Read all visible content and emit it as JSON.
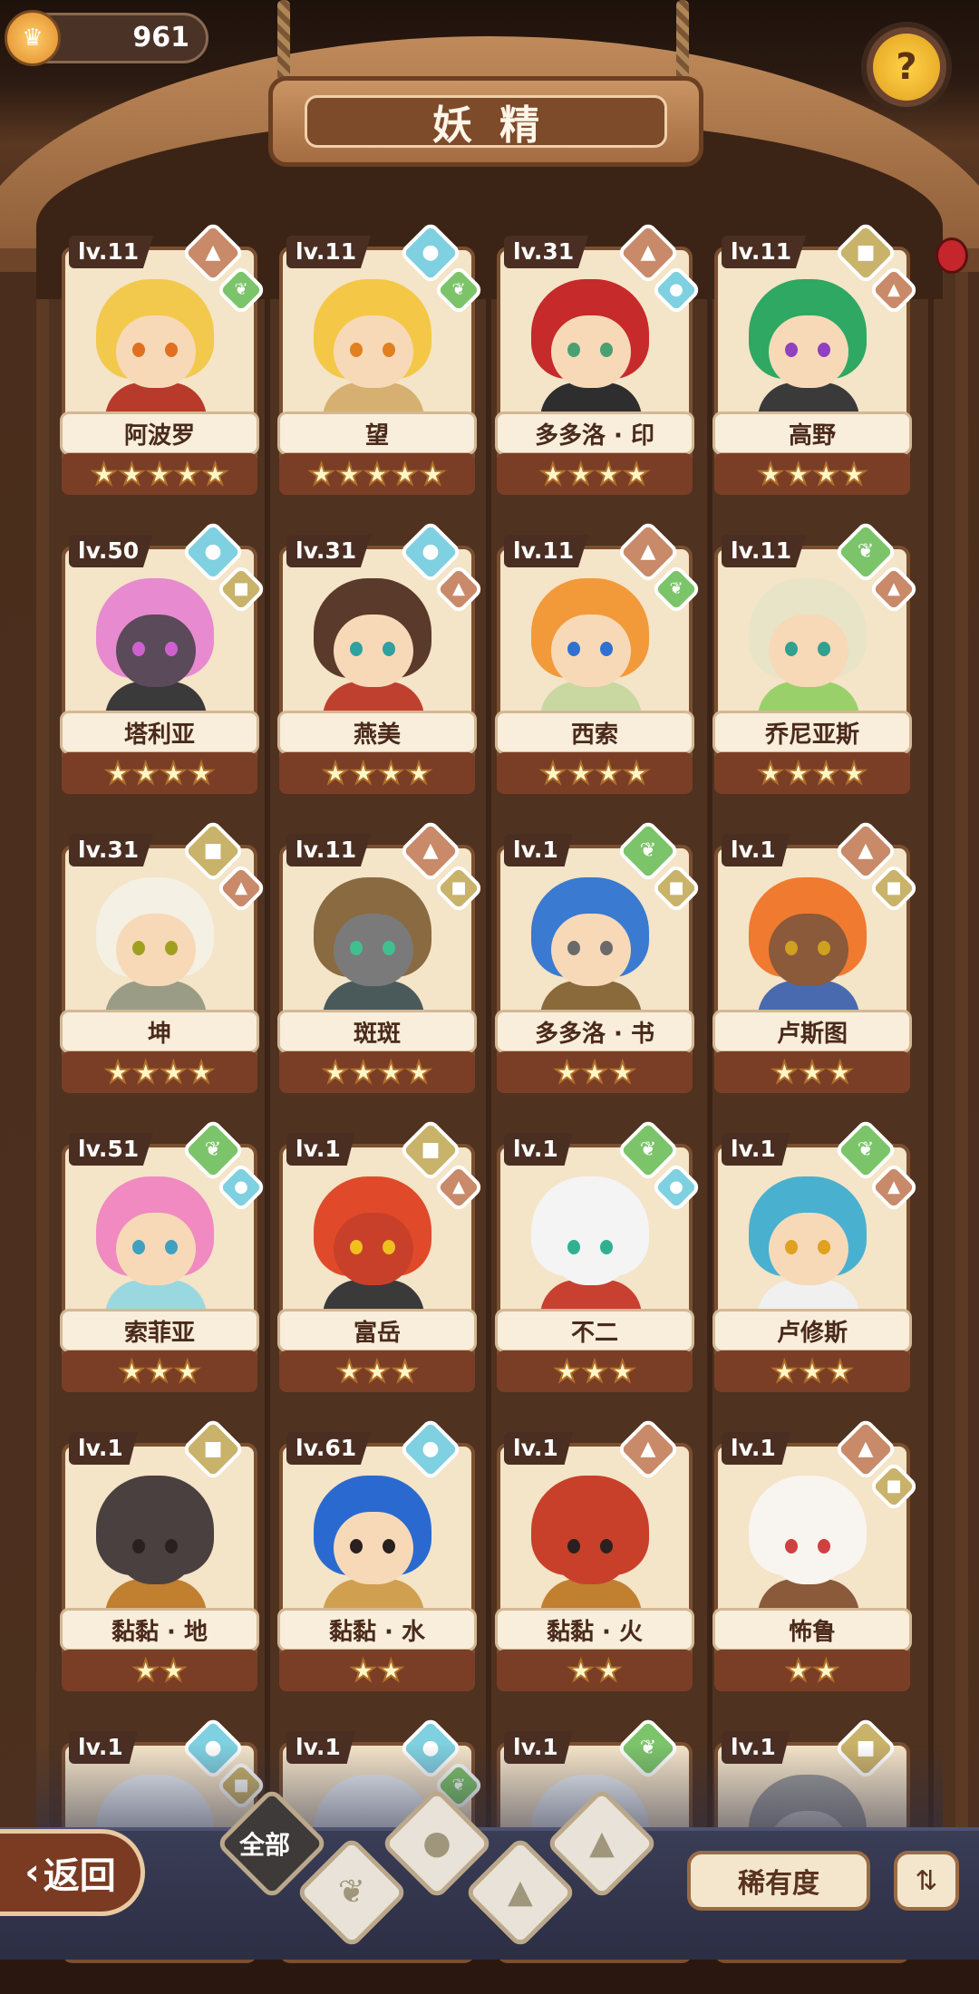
{
  "currency": {
    "value": "961"
  },
  "header": {
    "title": "妖精"
  },
  "bottom_bar": {
    "back_label": "返回",
    "filter_all_label": "全部",
    "sort_label": "稀有度",
    "sort_order_glyph": "⇅"
  },
  "colors": {
    "fire": "#c98a6a",
    "water": "#7fd0e0",
    "plant": "#7cc46a",
    "earth": "#c9b26a"
  },
  "fairies": [
    {
      "level": "lv.11",
      "name": "阿波罗",
      "stars": 5,
      "element": "fire",
      "secondary": "plant",
      "hair": "#f2c94c",
      "skin": "#f7d9b8",
      "outfit": "#b83a2a",
      "eye": "#e07020"
    },
    {
      "level": "lv.11",
      "name": "望",
      "stars": 5,
      "element": "water",
      "secondary": "plant",
      "hair": "#f4c846",
      "skin": "#f7d9b8",
      "outfit": "#d6b070",
      "eye": "#e08020"
    },
    {
      "level": "lv.31",
      "name": "多多洛 · 印",
      "stars": 4,
      "element": "fire",
      "secondary": "water",
      "hair": "#c62a2a",
      "skin": "#f7d9b8",
      "outfit": "#2e2e2e",
      "eye": "#4aa070"
    },
    {
      "level": "lv.11",
      "name": "高野",
      "stars": 4,
      "element": "earth",
      "secondary": "fire",
      "hair": "#2ea862",
      "skin": "#f7d9b8",
      "outfit": "#3a3a3a",
      "eye": "#9040c0"
    },
    {
      "level": "lv.50",
      "name": "塔利亚",
      "stars": 4,
      "element": "water",
      "secondary": "earth",
      "hair": "#e88ad0",
      "skin": "#5a4a5a",
      "outfit": "#3a3a3a",
      "eye": "#d060d0"
    },
    {
      "level": "lv.31",
      "name": "燕美",
      "stars": 4,
      "element": "water",
      "secondary": "fire",
      "hair": "#5a3a2a",
      "skin": "#f7d9b8",
      "outfit": "#c04030",
      "eye": "#30a0a0"
    },
    {
      "level": "lv.11",
      "name": "西索",
      "stars": 4,
      "element": "fire",
      "secondary": "plant",
      "hair": "#f29a3a",
      "skin": "#f7d9b8",
      "outfit": "#c8d8a0",
      "eye": "#3070d0"
    },
    {
      "level": "lv.11",
      "name": "乔尼亚斯",
      "stars": 4,
      "element": "plant",
      "secondary": "fire",
      "hair": "#e8e4c8",
      "skin": "#f7d9b8",
      "outfit": "#9ad06a",
      "eye": "#30a090"
    },
    {
      "level": "lv.31",
      "name": "坤",
      "stars": 4,
      "element": "earth",
      "secondary": "fire",
      "hair": "#f4f0e4",
      "skin": "#f7d9b8",
      "outfit": "#9a9c86",
      "eye": "#a0a020"
    },
    {
      "level": "lv.11",
      "name": "斑斑",
      "stars": 4,
      "element": "fire",
      "secondary": "earth",
      "hair": "#8a6a40",
      "skin": "#7a7a7a",
      "outfit": "#4a5a5a",
      "eye": "#40c090"
    },
    {
      "level": "lv.1",
      "name": "多多洛 · 书",
      "stars": 3,
      "element": "plant",
      "secondary": "earth",
      "hair": "#3a7ad0",
      "skin": "#f7d9b8",
      "outfit": "#8a6a3a",
      "eye": "#6a6a6a"
    },
    {
      "level": "lv.1",
      "name": "卢斯图",
      "stars": 3,
      "element": "fire",
      "secondary": "earth",
      "hair": "#f07a30",
      "skin": "#8a5a3a",
      "outfit": "#4a6ab0",
      "eye": "#d0a020"
    },
    {
      "level": "lv.51",
      "name": "索菲亚",
      "stars": 3,
      "element": "plant",
      "secondary": "water",
      "hair": "#f08ac0",
      "skin": "#f7d9b8",
      "outfit": "#9ad8e0",
      "eye": "#40a0c0"
    },
    {
      "level": "lv.1",
      "name": "富岳",
      "stars": 3,
      "element": "earth",
      "secondary": "fire",
      "hair": "#e04a2a",
      "skin": "#c8402a",
      "outfit": "#3a3a3a",
      "eye": "#f0c020"
    },
    {
      "level": "lv.1",
      "name": "不二",
      "stars": 3,
      "element": "plant",
      "secondary": "water",
      "hair": "#f4f4f4",
      "skin": "#f4f4f4",
      "outfit": "#c84030",
      "eye": "#30b090"
    },
    {
      "level": "lv.1",
      "name": "卢修斯",
      "stars": 3,
      "element": "plant",
      "secondary": "fire",
      "hair": "#4ab0d0",
      "skin": "#f7d9b8",
      "outfit": "#f0f0f0",
      "eye": "#e0a020"
    },
    {
      "level": "lv.1",
      "name": "黏黏 · 地",
      "stars": 2,
      "element": "earth",
      "secondary": "",
      "hair": "#4a4040",
      "skin": "#4a4040",
      "outfit": "#c08030",
      "eye": "#2a2020"
    },
    {
      "level": "lv.61",
      "name": "黏黏 · 水",
      "stars": 2,
      "element": "water",
      "secondary": "",
      "hair": "#2a6ad0",
      "skin": "#f7d9b8",
      "outfit": "#d0a050",
      "eye": "#2a2020"
    },
    {
      "level": "lv.1",
      "name": "黏黏 · 火",
      "stars": 2,
      "element": "fire",
      "secondary": "",
      "hair": "#c8402a",
      "skin": "#c8402a",
      "outfit": "#c08030",
      "eye": "#2a2020"
    },
    {
      "level": "lv.1",
      "name": "怖鲁",
      "stars": 2,
      "element": "fire",
      "secondary": "earth",
      "hair": "#f8f4f0",
      "skin": "#f8f4f0",
      "outfit": "#8a5a3a",
      "eye": "#d04040"
    },
    {
      "level": "lv.1",
      "name": "",
      "stars": 0,
      "element": "water",
      "secondary": "earth",
      "hair": "#e8eef4",
      "skin": "#e8eef4",
      "outfit": "#4a9ad0",
      "eye": "#2a2020"
    },
    {
      "level": "lv.1",
      "name": "",
      "stars": 0,
      "element": "water",
      "secondary": "plant",
      "hair": "#e8eef4",
      "skin": "#e8eef4",
      "outfit": "#4aa060",
      "eye": "#2a2020"
    },
    {
      "level": "lv.1",
      "name": "",
      "stars": 0,
      "element": "plant",
      "secondary": "",
      "hair": "#e8eef4",
      "skin": "#e8eef4",
      "outfit": "#4aa060",
      "eye": "#2a2020"
    },
    {
      "level": "lv.1",
      "name": "",
      "stars": 0,
      "element": "earth",
      "secondary": "",
      "hair": "#9a9a9a",
      "skin": "#c8c8c8",
      "outfit": "#6a6a6a",
      "eye": "#2a2020"
    }
  ]
}
